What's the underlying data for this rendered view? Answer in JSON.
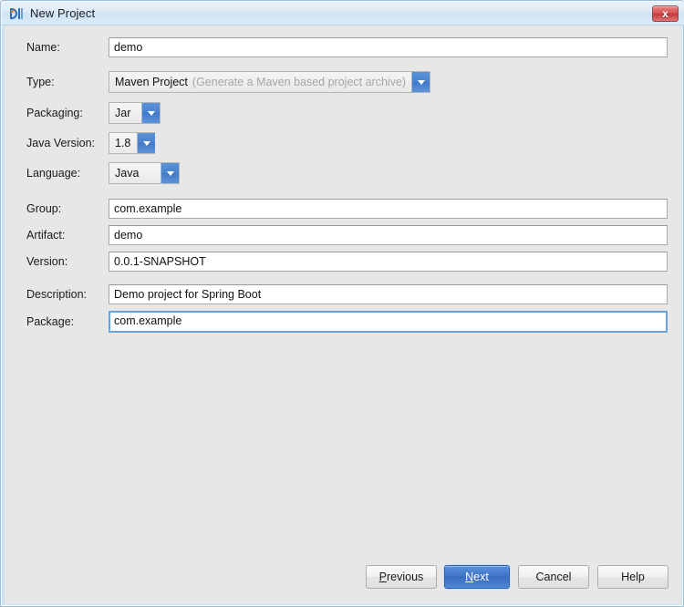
{
  "window": {
    "title": "New Project",
    "icon": "idea-module-icon",
    "close_label": "x",
    "accent_blue": "#4a82cd",
    "default_button_blue": "#3f73c6",
    "background": "#e7e7e7",
    "border": "#9ebfd9"
  },
  "form": {
    "fields": [
      {
        "label": "Name:",
        "value": "demo",
        "kind": "text",
        "name": "name"
      },
      {
        "label": "Type:",
        "value": "Maven Project",
        "hint": "(Generate a Maven based project archive)",
        "kind": "combo-wide",
        "name": "type"
      },
      {
        "label": "Packaging:",
        "value": "Jar",
        "kind": "combo",
        "name": "packaging"
      },
      {
        "label": "Java Version:",
        "value": "1.8",
        "kind": "combo",
        "name": "java-version"
      },
      {
        "label": "Language:",
        "value": "Java",
        "kind": "combo",
        "name": "language"
      },
      {
        "label": "Group:",
        "value": "com.example",
        "kind": "text",
        "name": "group"
      },
      {
        "label": "Artifact:",
        "value": "demo",
        "kind": "text",
        "name": "artifact"
      },
      {
        "label": "Version:",
        "value": "0.0.1-SNAPSHOT",
        "kind": "text",
        "name": "version"
      },
      {
        "label": "Description:",
        "value": "Demo project for Spring Boot",
        "kind": "text",
        "name": "description"
      },
      {
        "label": "Package:",
        "value": "com.example",
        "kind": "text",
        "name": "package",
        "focused": true
      }
    ]
  },
  "buttons": {
    "previous": {
      "label": "Previous",
      "mnemonic": "P"
    },
    "next": {
      "label": "Next",
      "mnemonic": "N",
      "default": true
    },
    "cancel": {
      "label": "Cancel"
    },
    "help": {
      "label": "Help"
    }
  }
}
